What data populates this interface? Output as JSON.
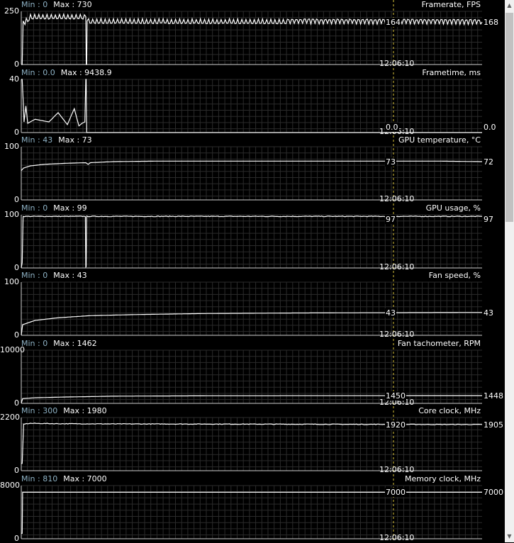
{
  "time_label": "12:06:10",
  "colors": {
    "background": "#000000",
    "line": "#ffffff",
    "grid": "#2b2b2b",
    "cursor": "#d8c23a",
    "min_text": "#8fb3c6"
  },
  "graphs": [
    {
      "title": "Framerate, FPS",
      "min_label": "Min : 0",
      "max_label": "Max : 730",
      "y_top": "250",
      "y_bottom": "0",
      "range": [
        0,
        250
      ],
      "cursor_value": "164",
      "right_value": "168",
      "trace": "oscillating",
      "data": [
        [
          0,
          0
        ],
        [
          2,
          0
        ],
        [
          4,
          205
        ],
        [
          8,
          200
        ],
        [
          20,
          225
        ],
        [
          140,
          225
        ],
        [
          141,
          0
        ],
        [
          142,
          0
        ],
        [
          143,
          205
        ],
        [
          1000,
          200
        ]
      ]
    },
    {
      "title": "Frametime, ms",
      "min_label": "Min : 0.0",
      "max_label": "Max : 9438.9",
      "y_top": "40",
      "y_bottom": "0",
      "range": [
        0,
        40
      ],
      "cursor_value": "0.0",
      "right_value": "0.0",
      "trace": "spiky",
      "data": [
        [
          0,
          40
        ],
        [
          2,
          40
        ],
        [
          4,
          25
        ],
        [
          6,
          8
        ],
        [
          10,
          20
        ],
        [
          14,
          7
        ],
        [
          30,
          10
        ],
        [
          60,
          8
        ],
        [
          80,
          15
        ],
        [
          100,
          6
        ],
        [
          115,
          18
        ],
        [
          125,
          5
        ],
        [
          132,
          7
        ],
        [
          138,
          8
        ],
        [
          140,
          40
        ],
        [
          141,
          40
        ],
        [
          142,
          0
        ],
        [
          143,
          0
        ],
        [
          1000,
          0
        ]
      ]
    },
    {
      "title": "GPU temperature, °C",
      "min_label": "Min : 43",
      "max_label": "Max : 73",
      "y_top": "100",
      "y_bottom": "0",
      "range": [
        0,
        100
      ],
      "cursor_value": "73",
      "right_value": "72",
      "trace": "smooth",
      "data": [
        [
          0,
          55
        ],
        [
          5,
          60
        ],
        [
          20,
          64
        ],
        [
          50,
          67
        ],
        [
          100,
          69
        ],
        [
          140,
          70
        ],
        [
          145,
          67
        ],
        [
          150,
          70
        ],
        [
          200,
          72
        ],
        [
          300,
          73
        ],
        [
          900,
          73
        ],
        [
          1000,
          72
        ]
      ]
    },
    {
      "title": "GPU usage, %",
      "min_label": "Min : 0",
      "max_label": "Max : 99",
      "y_top": "100",
      "y_bottom": "0",
      "range": [
        0,
        100
      ],
      "cursor_value": "97",
      "right_value": "97",
      "trace": "noisy",
      "data": [
        [
          0,
          0
        ],
        [
          2,
          10
        ],
        [
          4,
          97
        ],
        [
          139,
          97
        ],
        [
          140,
          2
        ],
        [
          141,
          2
        ],
        [
          142,
          97
        ],
        [
          1000,
          97
        ]
      ]
    },
    {
      "title": "Fan speed, %",
      "min_label": "Min : 0",
      "max_label": "Max : 43",
      "y_top": "100",
      "y_bottom": "0",
      "range": [
        0,
        100
      ],
      "cursor_value": "43",
      "right_value": "43",
      "trace": "smooth",
      "data": [
        [
          0,
          0
        ],
        [
          3,
          20
        ],
        [
          30,
          28
        ],
        [
          80,
          33
        ],
        [
          150,
          37
        ],
        [
          250,
          39
        ],
        [
          400,
          41
        ],
        [
          600,
          42
        ],
        [
          1000,
          43
        ]
      ]
    },
    {
      "title": "Fan tachometer, RPM",
      "min_label": "Min : 0",
      "max_label": "Max : 1462",
      "y_top": "10000",
      "y_bottom": "0",
      "range": [
        0,
        10000
      ],
      "cursor_value": "1450",
      "right_value": "1448",
      "trace": "smooth",
      "data": [
        [
          0,
          0
        ],
        [
          3,
          900
        ],
        [
          30,
          1050
        ],
        [
          100,
          1200
        ],
        [
          200,
          1350
        ],
        [
          400,
          1420
        ],
        [
          700,
          1445
        ],
        [
          1000,
          1450
        ]
      ]
    },
    {
      "title": "Core clock, MHz",
      "min_label": "Min : 300",
      "max_label": "Max : 1980",
      "y_top": "2200",
      "y_bottom": "0",
      "range": [
        0,
        2200
      ],
      "cursor_value": "1920",
      "right_value": "1905",
      "trace": "noisy",
      "data": [
        [
          0,
          300
        ],
        [
          2,
          300
        ],
        [
          5,
          1930
        ],
        [
          20,
          1960
        ],
        [
          80,
          1945
        ],
        [
          200,
          1935
        ],
        [
          1000,
          1910
        ]
      ]
    },
    {
      "title": "Memory clock, MHz",
      "min_label": "Min : 810",
      "max_label": "Max : 7000",
      "y_top": "8000",
      "y_bottom": "0",
      "range": [
        0,
        8000
      ],
      "cursor_value": "7000",
      "right_value": "7000",
      "trace": "flat",
      "data": [
        [
          0,
          810
        ],
        [
          2,
          810
        ],
        [
          3,
          7000
        ],
        [
          1000,
          7000
        ]
      ]
    }
  ]
}
